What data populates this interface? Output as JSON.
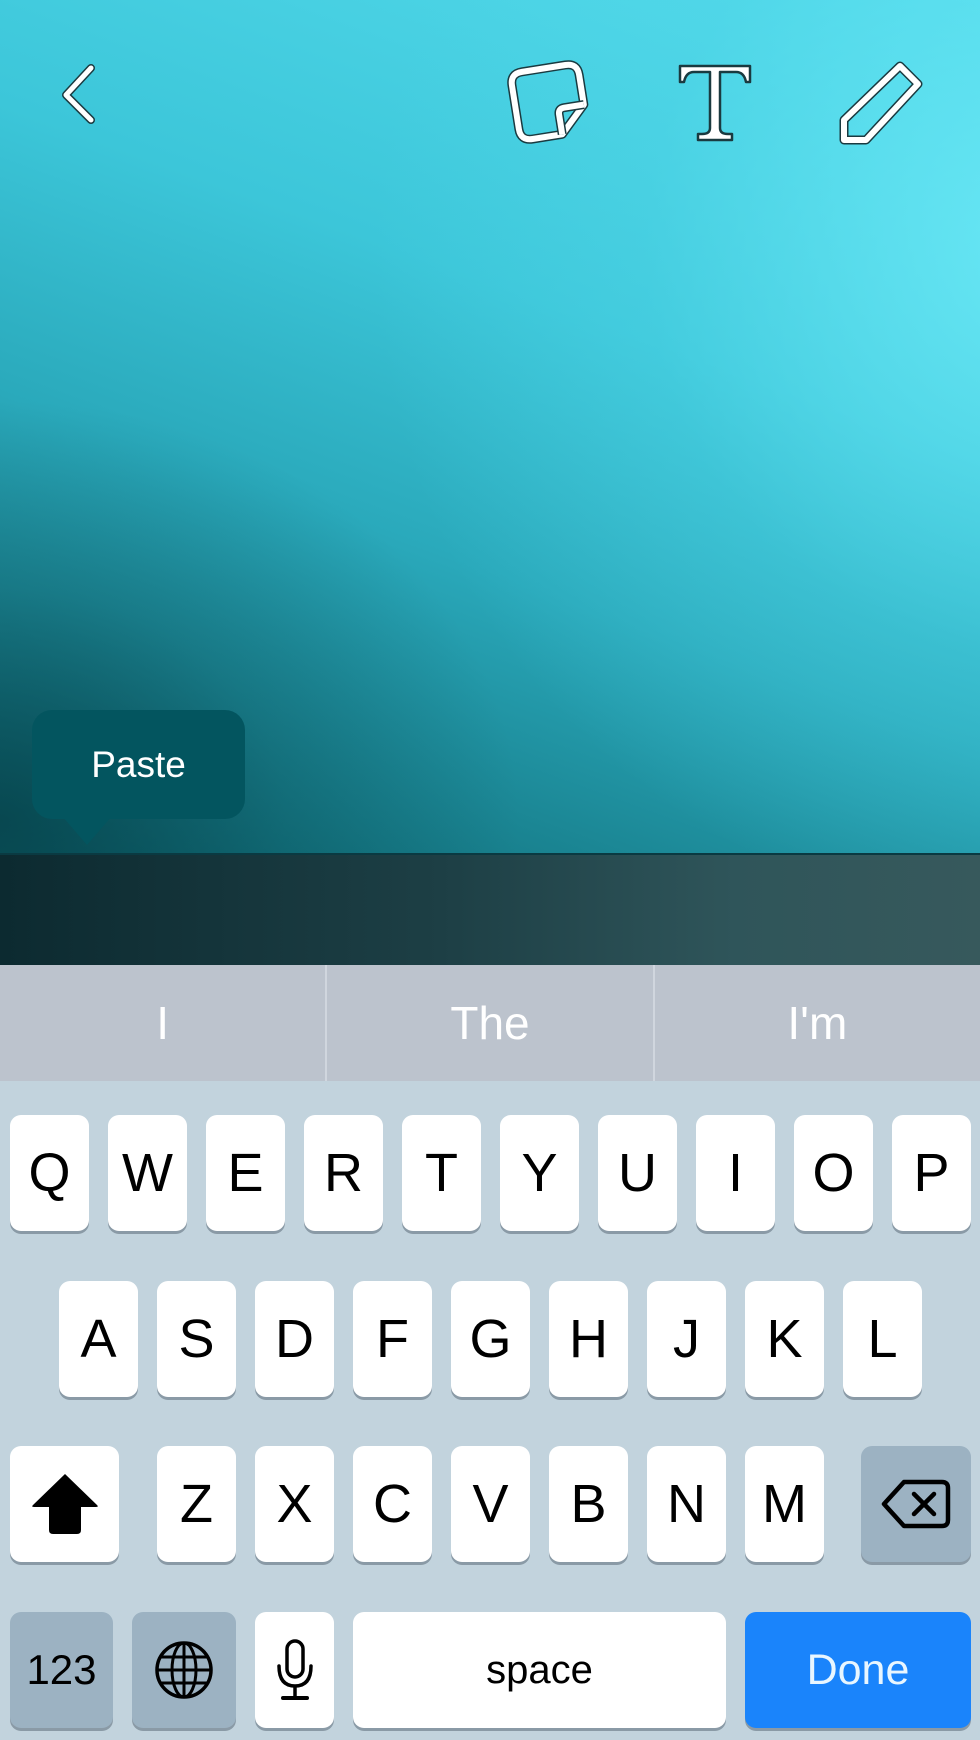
{
  "toolbar": {
    "back_icon": "chevron-left-icon",
    "sticker_icon": "sticker-icon",
    "text_icon": "text-T-icon",
    "draw_icon": "pencil-icon"
  },
  "context_menu": {
    "paste_label": "Paste"
  },
  "suggestions": [
    "I",
    "The",
    "I'm"
  ],
  "keyboard": {
    "row1": [
      "Q",
      "W",
      "E",
      "R",
      "T",
      "Y",
      "U",
      "I",
      "O",
      "P"
    ],
    "row2": [
      "A",
      "S",
      "D",
      "F",
      "G",
      "H",
      "J",
      "K",
      "L"
    ],
    "row3": [
      "Z",
      "X",
      "C",
      "V",
      "B",
      "N",
      "M"
    ],
    "shift_icon": "shift-arrow-icon",
    "shift_active": true,
    "delete_icon": "backspace-icon",
    "numbers_label": "123",
    "globe_icon": "globe-icon",
    "mic_icon": "microphone-icon",
    "space_label": "space",
    "done_label": "Done"
  },
  "colors": {
    "canvas_teal": "#3cc6d9",
    "paste_bubble": "#03555f",
    "suggestion_bar": "#bcc3cd",
    "keyboard_bg": "#c2d3dd",
    "modifier_key": "#9cb2c2",
    "done_blue": "#1a84fb"
  }
}
